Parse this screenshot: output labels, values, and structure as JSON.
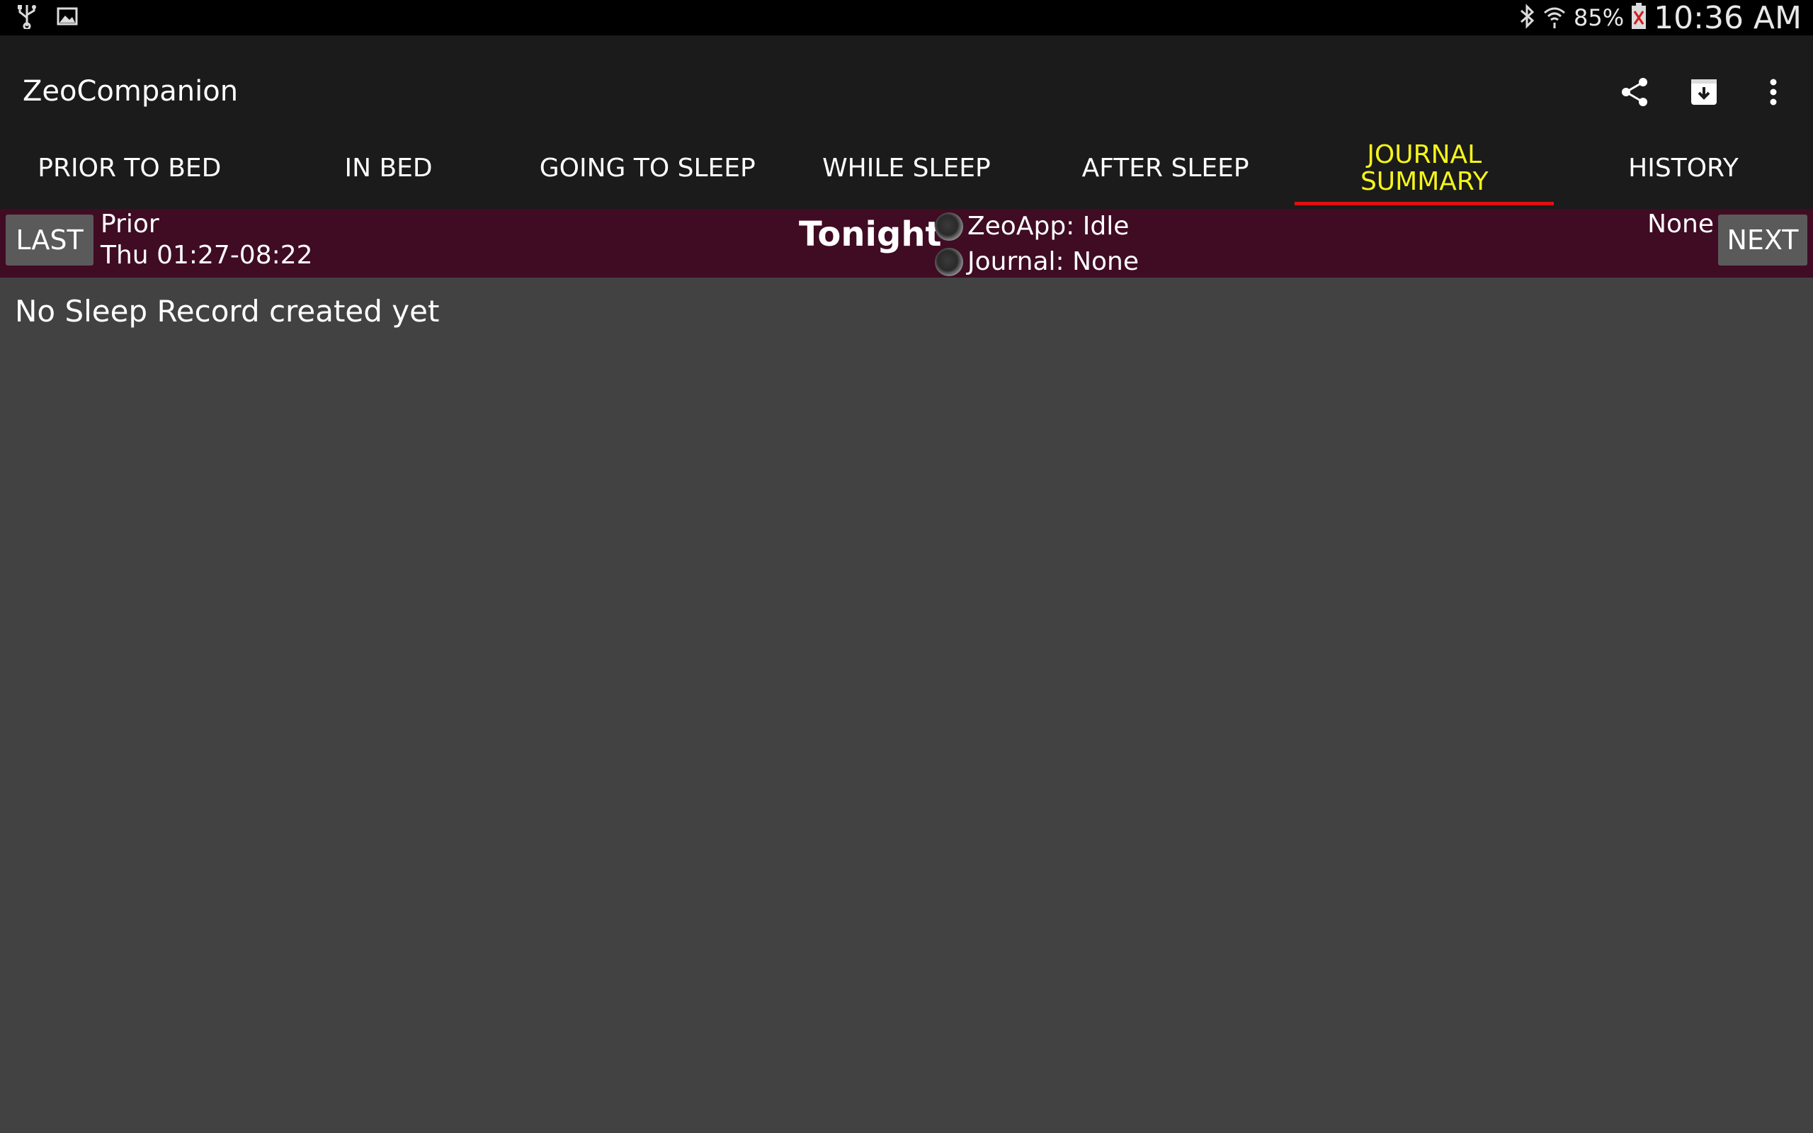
{
  "status_bar": {
    "left_icons": [
      "usb-icon",
      "image-icon"
    ],
    "right_icons": [
      "bluetooth-icon",
      "wifi-icon",
      "battery-icon"
    ],
    "battery_percent": "85%",
    "time": "10:36 AM"
  },
  "app": {
    "title": "ZeoCompanion",
    "actions": [
      "share-icon",
      "archive-download-icon",
      "overflow-menu-icon"
    ]
  },
  "tabs": [
    {
      "label": "PRIOR TO BED",
      "active": false
    },
    {
      "label": "IN BED",
      "active": false
    },
    {
      "label": "GOING TO SLEEP",
      "active": false
    },
    {
      "label": "WHILE SLEEP",
      "active": false
    },
    {
      "label": "AFTER SLEEP",
      "active": false
    },
    {
      "label": "JOURNAL\nSUMMARY",
      "active": true
    },
    {
      "label": "HISTORY",
      "active": false
    }
  ],
  "colors": {
    "active_tab_text": "#f5f51a",
    "active_tab_indicator": "#e01010",
    "header_bar": "#3f0c23",
    "content_bg": "#424242",
    "action_bar": "#1b1b1b"
  },
  "header": {
    "last_button": "LAST",
    "prior_label": "Prior",
    "prior_time": "Thu 01:27-08:22",
    "tonight": "Tonight",
    "zeoapp_status": "ZeoApp: Idle",
    "journal_status": "Journal: None",
    "next_label": "None",
    "next_button": "NEXT"
  },
  "content": {
    "message": "No Sleep Record created yet"
  }
}
